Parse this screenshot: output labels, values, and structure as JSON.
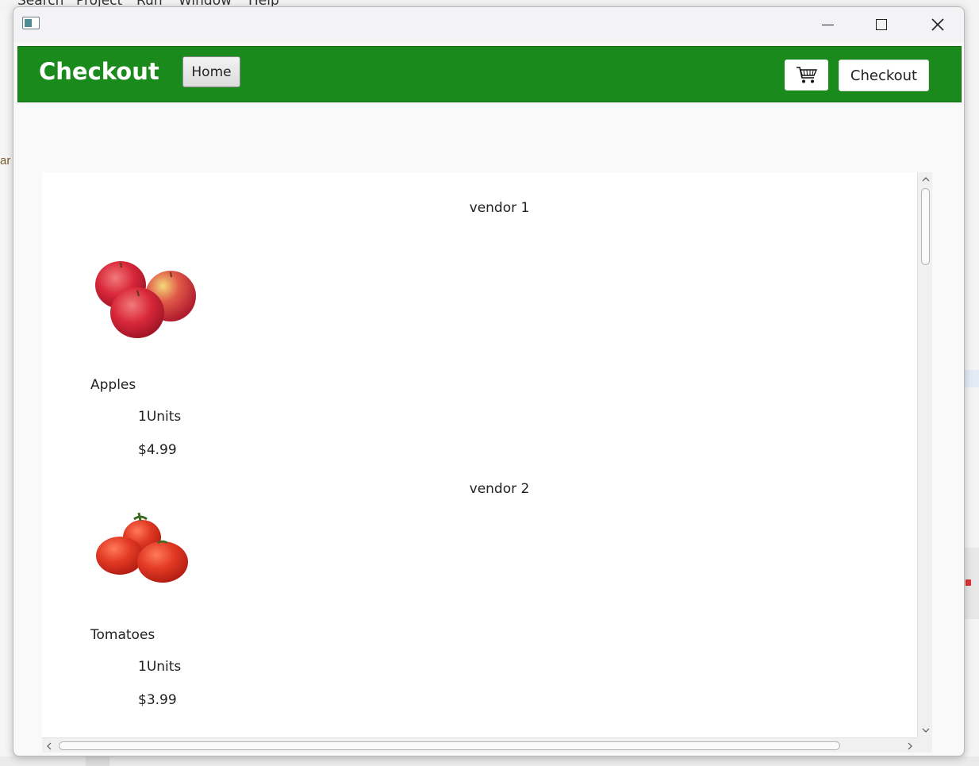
{
  "background_ide": {
    "menu": [
      "Search",
      "Project",
      "Run",
      "Window",
      "Help"
    ]
  },
  "window": {
    "controls": {
      "minimize_icon": "minimize-icon",
      "maximize_icon": "maximize-icon",
      "close_icon": "close-icon"
    }
  },
  "header": {
    "title": "Checkout",
    "home_label": "Home",
    "cart_icon": "shopping-cart-icon",
    "checkout_label": "Checkout",
    "color": "#1a8a1d"
  },
  "vendors": [
    {
      "name": "vendor 1",
      "product": {
        "name": "Apples",
        "units": "1Units",
        "price": "$4.99",
        "image_icon": "apples-image"
      }
    },
    {
      "name": "vendor 2",
      "product": {
        "name": "Tomatoes",
        "units": "1Units",
        "price": "$3.99",
        "image_icon": "tomatoes-image"
      }
    }
  ]
}
